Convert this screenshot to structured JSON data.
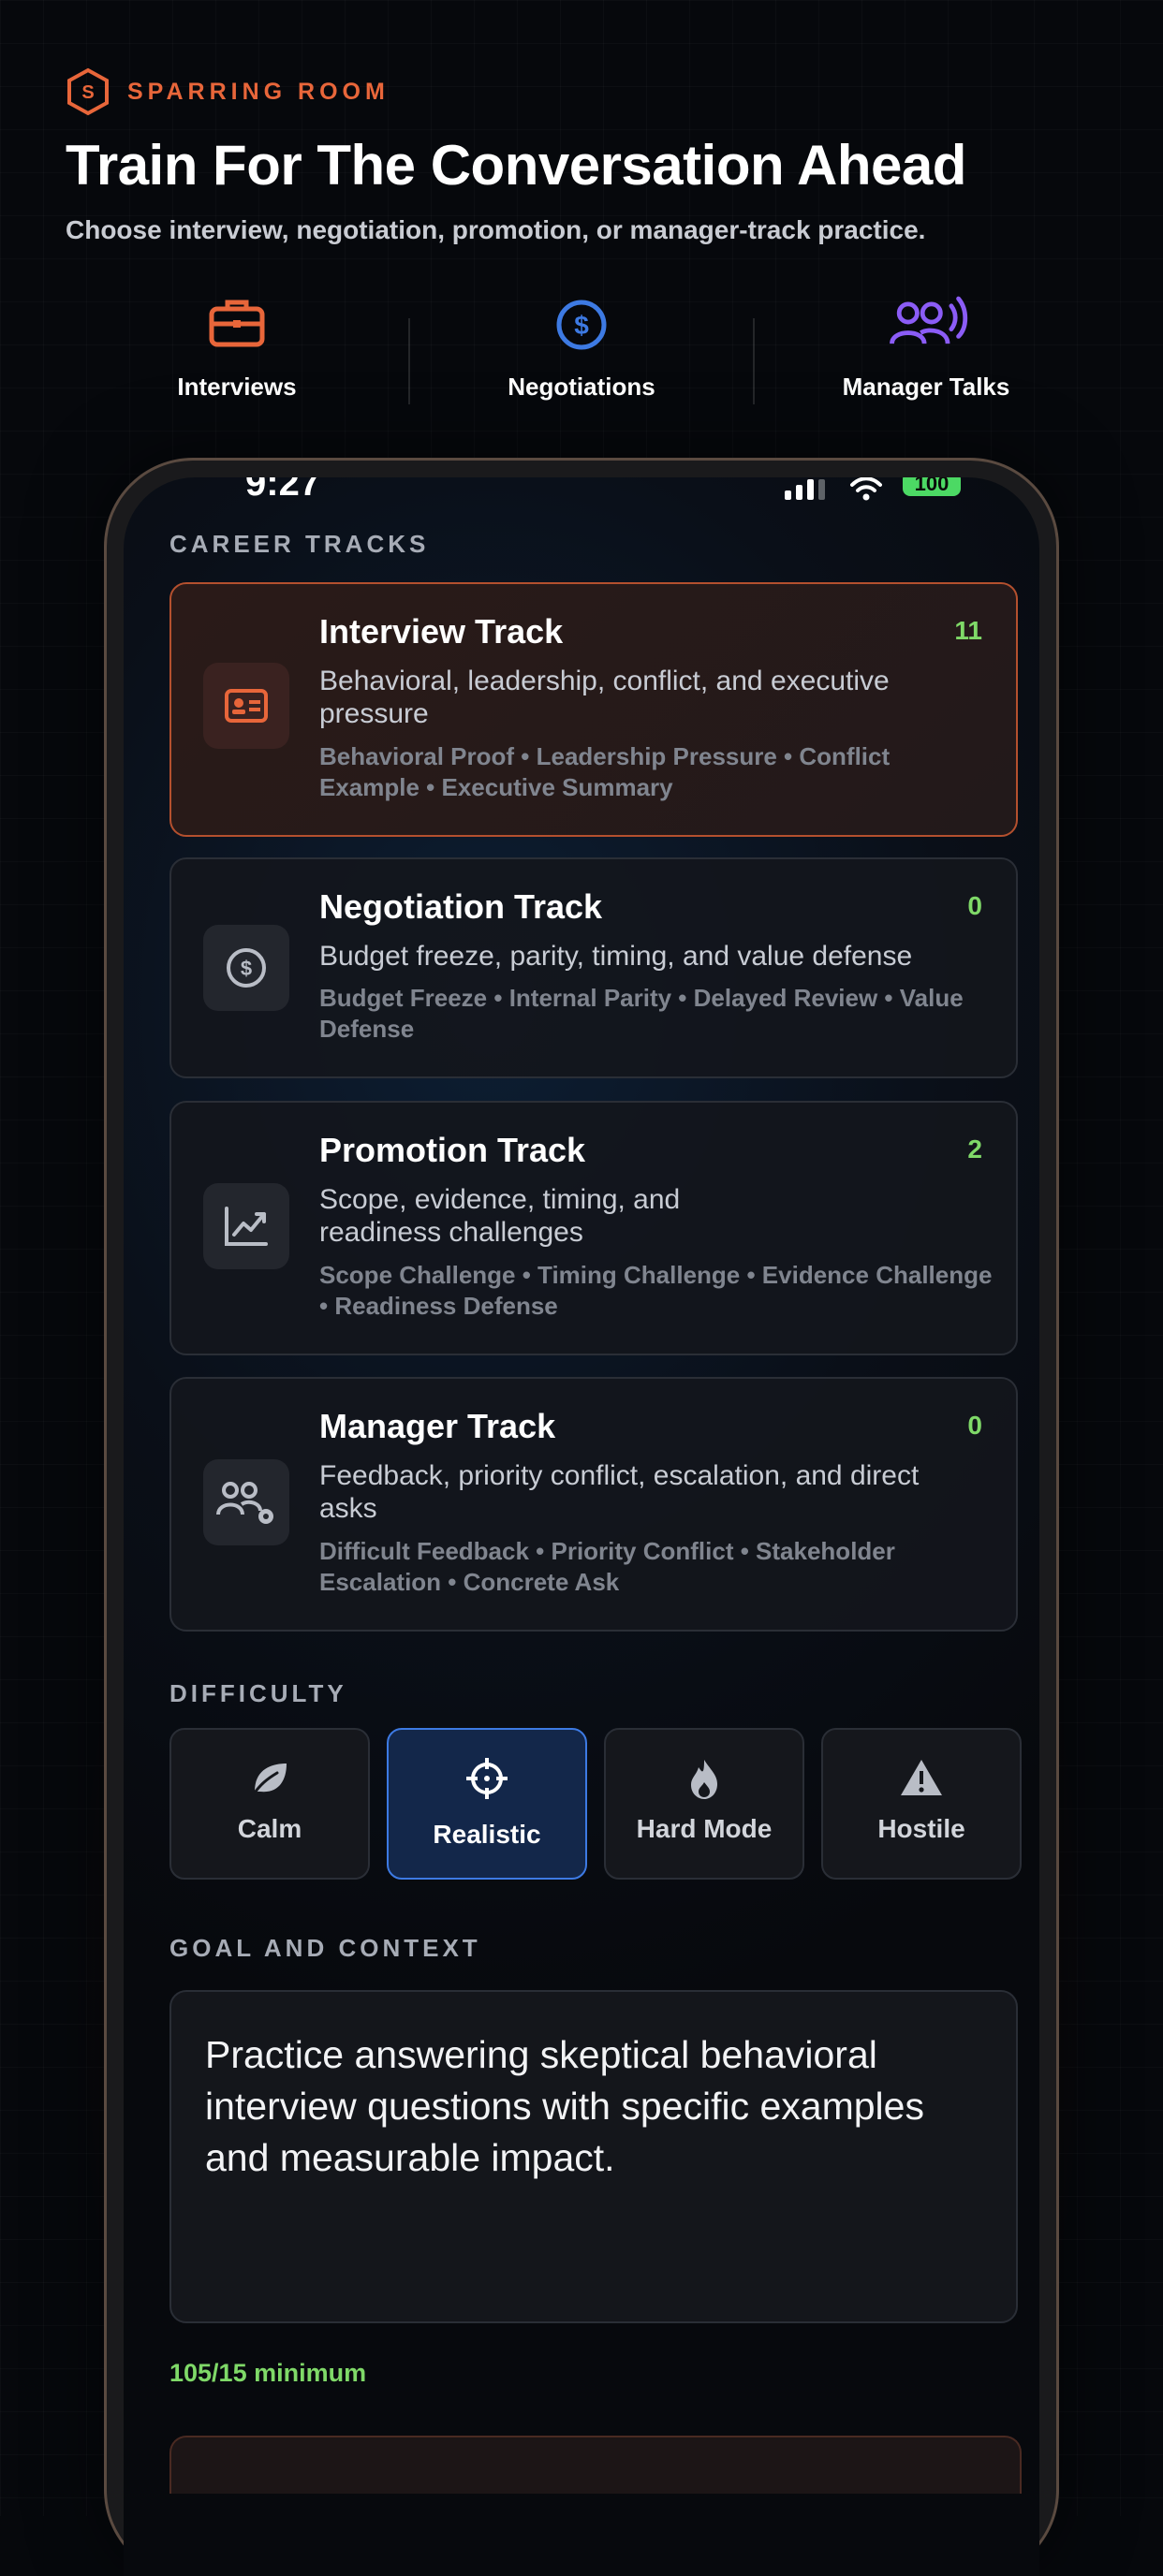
{
  "brand": {
    "name": "SPARRING ROOM",
    "accent": "#e8663a"
  },
  "header": {
    "title": "Train For The Conversation Ahead",
    "subtitle": "Choose interview, negotiation, promotion, or manager-track practice."
  },
  "features": [
    {
      "label": "Interviews",
      "icon": "briefcase-icon",
      "color": "#e8663a"
    },
    {
      "label": "Negotiations",
      "icon": "dollar-circle-icon",
      "color": "#3d7ae3"
    },
    {
      "label": "Manager Talks",
      "icon": "people-voice-icon",
      "color": "#8b5cf6"
    }
  ],
  "status_bar": {
    "time": "9:27",
    "battery": "100"
  },
  "career_tracks": {
    "label": "CAREER TRACKS",
    "items": [
      {
        "title": "Interview Track",
        "count": "11",
        "icon": "id-card-icon",
        "description": "Behavioral, leadership, conflict, and executive pressure",
        "tags": "Behavioral Proof • Leadership Pressure • Conflict Example • Executive Summary",
        "selected": true
      },
      {
        "title": "Negotiation Track",
        "count": "0",
        "icon": "dollar-circle-icon",
        "description": "Budget freeze, parity, timing, and value defense",
        "tags": "Budget Freeze • Internal Parity • Delayed Review • Value Defense",
        "selected": false
      },
      {
        "title": "Promotion Track",
        "count": "2",
        "icon": "chart-up-icon",
        "description": "Scope, evidence, timing, and readiness challenges",
        "tags": "Scope Challenge • Timing Challenge • Evidence Challenge • Readiness Defense",
        "selected": false
      },
      {
        "title": "Manager Track",
        "count": "0",
        "icon": "people-gear-icon",
        "description": "Feedback, priority conflict, escalation, and direct asks",
        "tags": "Difficult Feedback • Priority Conflict • Stakeholder Escalation • Concrete Ask",
        "selected": false
      }
    ]
  },
  "difficulty": {
    "label": "DIFFICULTY",
    "options": [
      {
        "label": "Calm",
        "icon": "leaf-icon",
        "selected": false
      },
      {
        "label": "Realistic",
        "icon": "crosshair-icon",
        "selected": true
      },
      {
        "label": "Hard Mode",
        "icon": "flame-icon",
        "selected": false
      },
      {
        "label": "Hostile",
        "icon": "warning-icon",
        "selected": false
      }
    ]
  },
  "goal": {
    "label": "GOAL AND CONTEXT",
    "value": "Practice answering skeptical behavioral interview questions with specific examples and measurable impact.",
    "counter": "105/15 minimum"
  }
}
